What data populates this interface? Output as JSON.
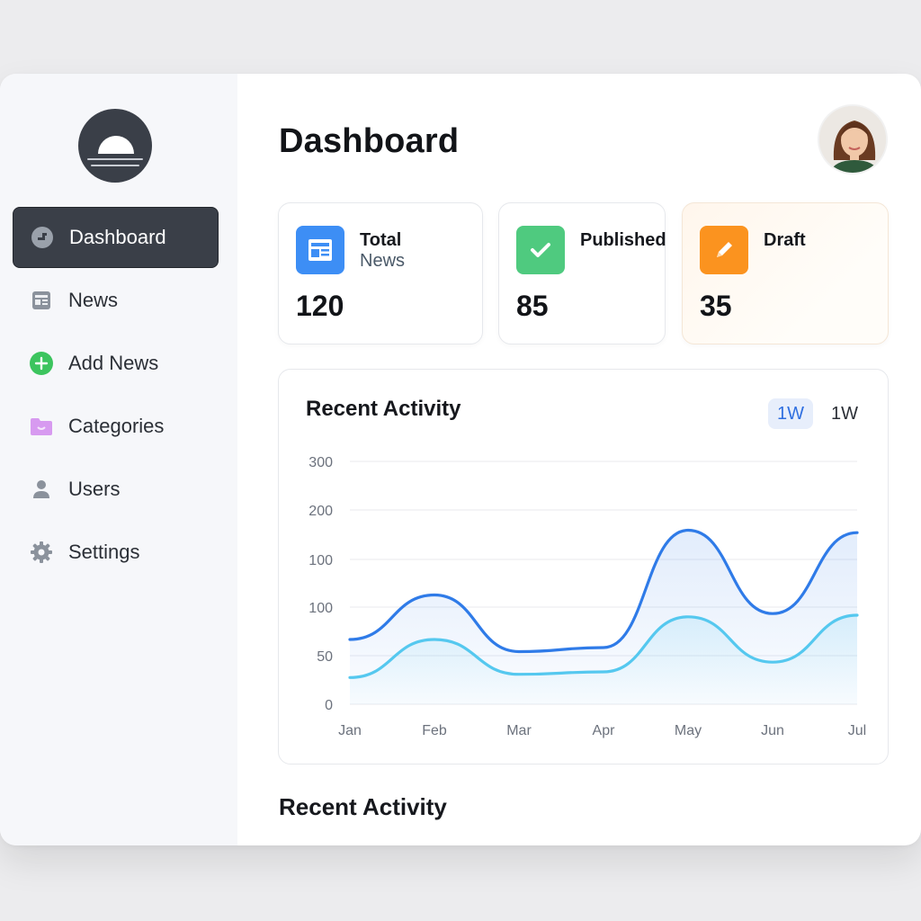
{
  "sidebar": {
    "items": [
      {
        "label": "Dashboard",
        "icon": "dashboard-icon",
        "active": true
      },
      {
        "label": "News",
        "icon": "newspaper-icon"
      },
      {
        "label": "Add News",
        "icon": "plus-circle-icon"
      },
      {
        "label": "Categories",
        "icon": "folder-icon"
      },
      {
        "label": "Users",
        "icon": "user-icon"
      },
      {
        "label": "Settings",
        "icon": "gear-icon"
      }
    ]
  },
  "header": {
    "title": "Dashboard"
  },
  "stats": [
    {
      "title": "Total",
      "subtitle": "News",
      "value": "120",
      "icon": "newspaper-icon",
      "color": "#3d8ef5"
    },
    {
      "title": "Published",
      "subtitle": "",
      "value": "85",
      "icon": "check-icon",
      "color": "#4fca7f"
    },
    {
      "title": "Draft",
      "subtitle": "",
      "value": "35",
      "icon": "pencil-icon",
      "color": "#fb931f"
    }
  ],
  "activity": {
    "title": "Recent Activity",
    "range_active": "1W",
    "range_other": "1W"
  },
  "chart_data": {
    "type": "area",
    "x": [
      "Jan",
      "Feb",
      "Mar",
      "Apr",
      "May",
      "Jun",
      "Jul"
    ],
    "y_ticks": [
      "300",
      "200",
      "100",
      "100",
      "50",
      "0"
    ],
    "grid": true,
    "series": [
      {
        "values": [
          80,
          135,
          65,
          70,
          215,
          112,
          212
        ],
        "color": "#2f7be8"
      },
      {
        "values": [
          33,
          80,
          37,
          40,
          108,
          52,
          110
        ],
        "color": "#55c8ef"
      }
    ]
  },
  "section2": {
    "title": "Recent Activity"
  }
}
